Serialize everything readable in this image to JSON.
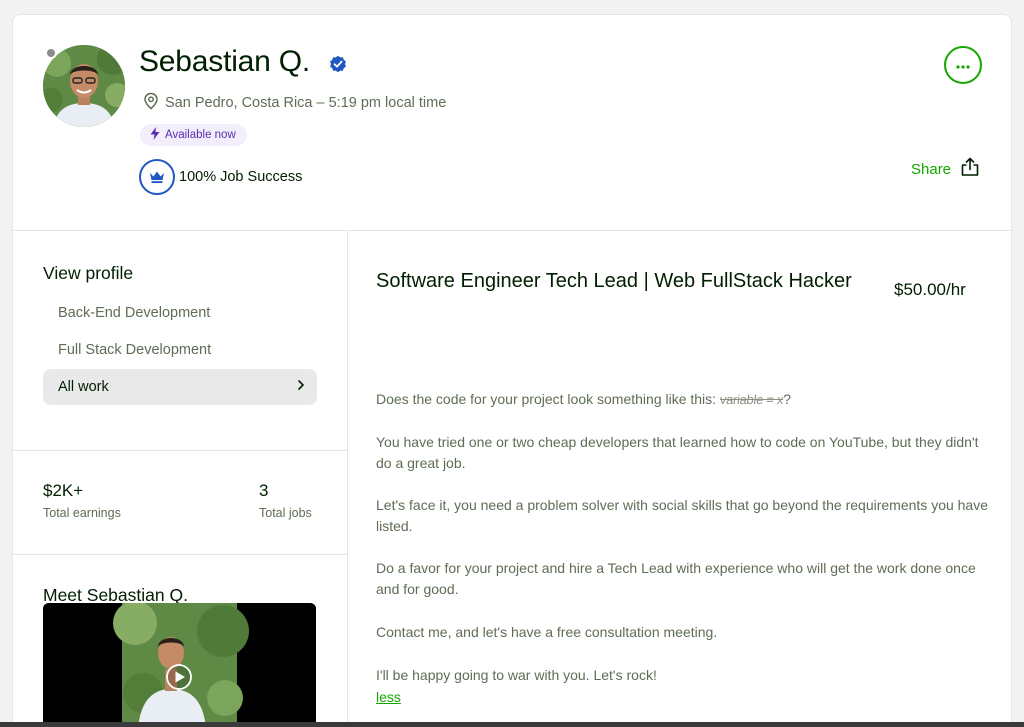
{
  "profile": {
    "name": "Sebastian Q.",
    "location": "San Pedro, Costa Rica – 5:19 pm local time",
    "availability": "Available now",
    "job_success": "100% Job Success",
    "share_label": "Share"
  },
  "sidebar": {
    "view_profile_title": "View profile",
    "items": [
      {
        "label": "Back-End Development"
      },
      {
        "label": "Full Stack Development"
      },
      {
        "label": "All work",
        "active": true
      }
    ],
    "stats": [
      {
        "value": "$2K+",
        "label": "Total earnings"
      },
      {
        "value": "3",
        "label": "Total jobs"
      }
    ],
    "meet_title": "Meet Sebastian Q."
  },
  "main": {
    "headline": "Software Engineer Tech Lead | Web FullStack Hacker",
    "rate": "$50.00/hr",
    "intro_prefix": "Does the code for your project look something like this: ",
    "intro_code": "variable = x",
    "intro_suffix": "?",
    "paragraphs": [
      "You have tried one or two cheap developers that learned how to code on YouTube, but they didn't do a great job.",
      "Let's face it, you need a problem solver with social skills that go beyond the requirements you have listed.",
      "Do a favor for your project and hire a Tech Lead with experience who will get the work done once and for good.",
      "Contact me, and let's have a free consultation meeting.",
      "I'll be happy going to war with you. Let's rock!"
    ],
    "less_label": "less"
  },
  "colors": {
    "brand_green": "#14a800",
    "verified_blue": "#1f57c3",
    "available_purple": "#5a2db0"
  },
  "icons": [
    "verified-badge-icon",
    "location-pin-icon",
    "lightning-icon",
    "crown-icon",
    "more-dots-icon",
    "share-icon",
    "chevron-right-icon",
    "play-icon"
  ]
}
